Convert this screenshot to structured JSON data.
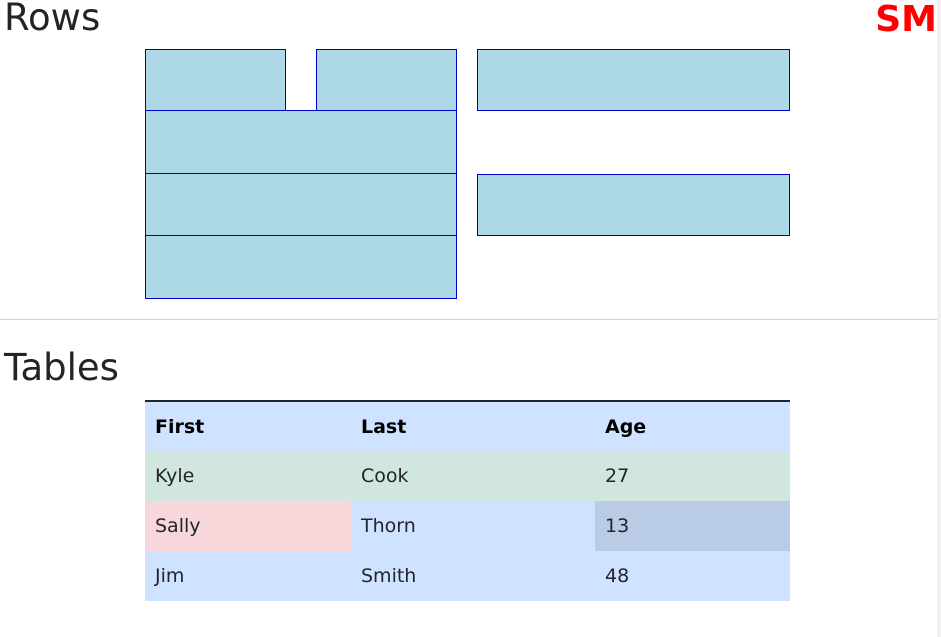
{
  "page": {
    "rows_heading": "Rows",
    "tables_heading": "Tables",
    "breakpoint_badge": "SM"
  },
  "colors": {
    "box_fill": "#add8e6",
    "box_border": "#0000cd",
    "breakpoint": "#ff0000",
    "table_primary": "#cfe2ff",
    "table_success": "#d1e7dd",
    "table_danger": "#f8d7da",
    "table_active": "#bacbe6"
  },
  "table": {
    "headers": [
      "First",
      "Last",
      "Age"
    ],
    "rows": [
      [
        "Kyle",
        "Cook",
        "27"
      ],
      [
        "Sally",
        "Thorn",
        "13"
      ],
      [
        "Jim",
        "Smith",
        "48"
      ]
    ]
  }
}
